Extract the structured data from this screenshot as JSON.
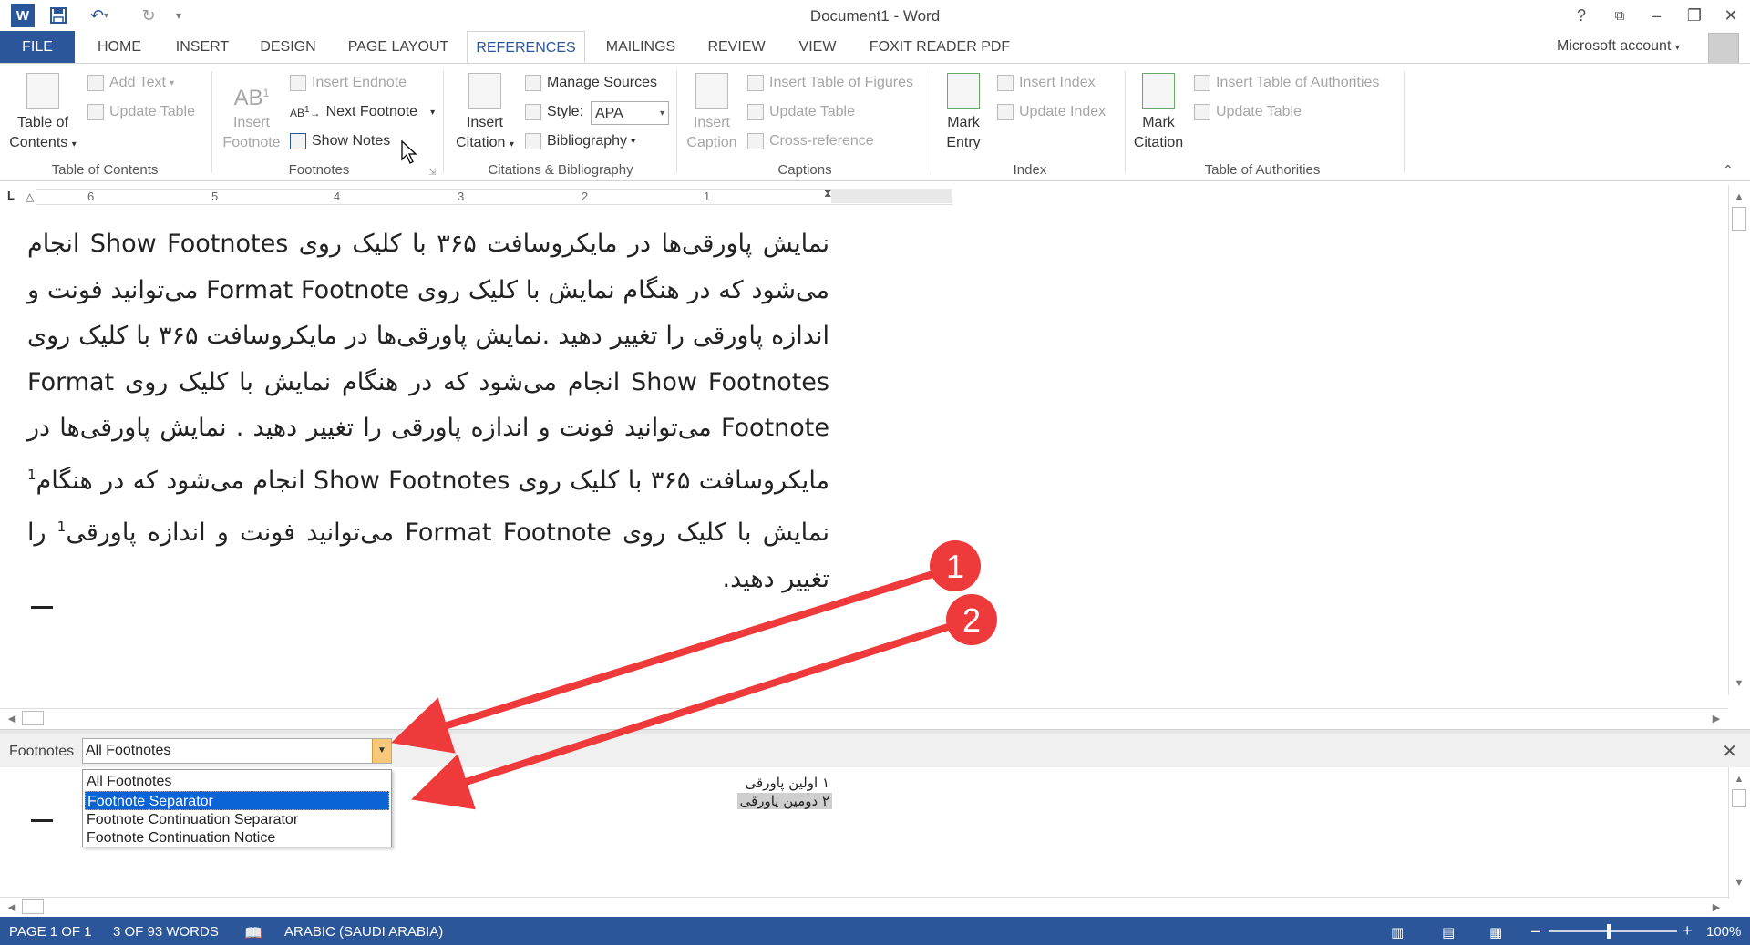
{
  "window": {
    "title": "Document1 - Word",
    "controls": {
      "help": "?",
      "min": "–",
      "restore": "❐",
      "close": "✕"
    }
  },
  "tabs": [
    "FILE",
    "HOME",
    "INSERT",
    "DESIGN",
    "PAGE LAYOUT",
    "REFERENCES",
    "MAILINGS",
    "REVIEW",
    "VIEW",
    "FOXIT READER PDF"
  ],
  "account": "Microsoft account",
  "ribbon": {
    "toc": {
      "big_line1": "Table of",
      "big_line2": "Contents",
      "add_text": "Add Text",
      "update_table": "Update Table",
      "group": "Table of Contents"
    },
    "footnotes": {
      "insert_line1": "Insert",
      "insert_line2": "Footnote",
      "insert_endnote": "Insert Endnote",
      "next_footnote": "Next Footnote",
      "show_notes": "Show Notes",
      "group": "Footnotes"
    },
    "citations": {
      "insert_line1": "Insert",
      "insert_line2": "Citation",
      "manage_sources": "Manage Sources",
      "style_label": "Style:",
      "style_value": "APA",
      "bibliography": "Bibliography",
      "group": "Citations & Bibliography"
    },
    "captions": {
      "insert_line1": "Insert",
      "insert_line2": "Caption",
      "insert_tof": "Insert Table of Figures",
      "update_table": "Update Table",
      "cross_reference": "Cross-reference",
      "group": "Captions"
    },
    "index": {
      "mark_line1": "Mark",
      "mark_line2": "Entry",
      "insert_index": "Insert Index",
      "update_index": "Update Index",
      "group": "Index"
    },
    "toa": {
      "mark_line1": "Mark",
      "mark_line2": "Citation",
      "insert_toa": "Insert Table of Authorities",
      "update_table": "Update Table",
      "group": "Table of Authorities"
    }
  },
  "ruler": {
    "numbers": [
      "6",
      "5",
      "4",
      "3",
      "2",
      "1"
    ],
    "corner": "L"
  },
  "document": {
    "text_part1": "نمایش پاورقی‌ها در مایکروسافت ۳۶۵ با کلیک روی Show Footnotes انجام می‌شود که در هنگام نمایش با کلیک روی Format Footnote می‌توانید فونت و اندازه پاورقی را تغییر دهید .نمایش پاورقی‌ها در مایکروسافت ۳۶۵ با کلیک روی Show Footnotes انجام می‌شود که در هنگام نمایش با کلیک روی Format Footnote می‌توانید فونت و اندازه پاورقی را تغییر دهید . نمایش پاورقی‌ها در مایکروسافت ۳۶۵ با کلیک روی Show Footnotes انجام می‌شود که در هنگام",
    "ref1": "1",
    "text_part2": " نمایش با کلیک روی Format Footnote می‌توانید فونت و اندازه پاورقی",
    "ref2": "1",
    "text_part3": " را تغییر دهید."
  },
  "footnote_pane": {
    "label": "Footnotes",
    "selected": "All Footnotes",
    "options": [
      "All Footnotes",
      "Footnote Separator",
      "Footnote Continuation Separator",
      "Footnote Continuation Notice"
    ],
    "highlighted_index": 1,
    "close": "✕",
    "entries": [
      {
        "num": "١",
        "text": "اولین پاورقی"
      },
      {
        "num": "٢",
        "text": "دومین پاورقی"
      }
    ]
  },
  "annotations": [
    {
      "label": "1"
    },
    {
      "label": "2"
    }
  ],
  "status": {
    "page": "PAGE 1 OF 1",
    "words": "3 OF 93 WORDS",
    "language": "ARABIC (SAUDI ARABIA)",
    "zoom": "100%",
    "zoom_minus": "–",
    "zoom_plus": "+"
  },
  "colors": {
    "accent": "#2b579a",
    "annotation_red": "#ee3a3a",
    "selection_blue": "#0c63d6"
  }
}
